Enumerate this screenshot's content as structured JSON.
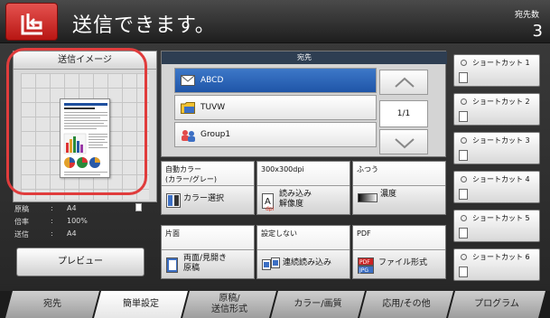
{
  "header": {
    "message": "送信できます。",
    "dest_count_label": "宛先数",
    "dest_count": "3"
  },
  "preview": {
    "title": "送信イメージ",
    "original_label": "原稿",
    "original_value": "A4",
    "zoom_label": "倍率",
    "zoom_value": "100%",
    "send_label": "送信",
    "send_value": "A4",
    "button_label": "プレビュー"
  },
  "destination": {
    "title": "宛先",
    "items": [
      {
        "label": "ABCD",
        "icon": "mail-icon"
      },
      {
        "label": "TUVW",
        "icon": "folder-icon"
      },
      {
        "label": "Group1",
        "icon": "group-icon"
      }
    ],
    "page_indicator": "1/1"
  },
  "settings": {
    "color": {
      "value": "自動カラー\n(カラー/グレー)",
      "label": "カラー選択"
    },
    "resolution": {
      "value": "300x300dpi",
      "label": "読み込み\n解像度"
    },
    "density": {
      "value": "ふつう",
      "label": "濃度"
    },
    "duplex": {
      "value": "片面",
      "label": "両面/見開き\n原稿"
    },
    "continuous": {
      "value": "設定しない",
      "label": "連続読み込み"
    },
    "file_format": {
      "value": "PDF",
      "label": "ファイル形式"
    }
  },
  "shortcuts": [
    "ショートカット 1",
    "ショートカット 2",
    "ショートカット 3",
    "ショートカット 4",
    "ショートカット 5",
    "ショートカット 6"
  ],
  "tabs": [
    "宛先",
    "簡単設定",
    "原稿/\n送信形式",
    "カラー/画質",
    "応用/その他",
    "プログラム"
  ],
  "colors": {
    "accent_red": "#d32f2c",
    "selected_blue": "#2a62b8",
    "preview_highlight": "#e03c3c"
  }
}
